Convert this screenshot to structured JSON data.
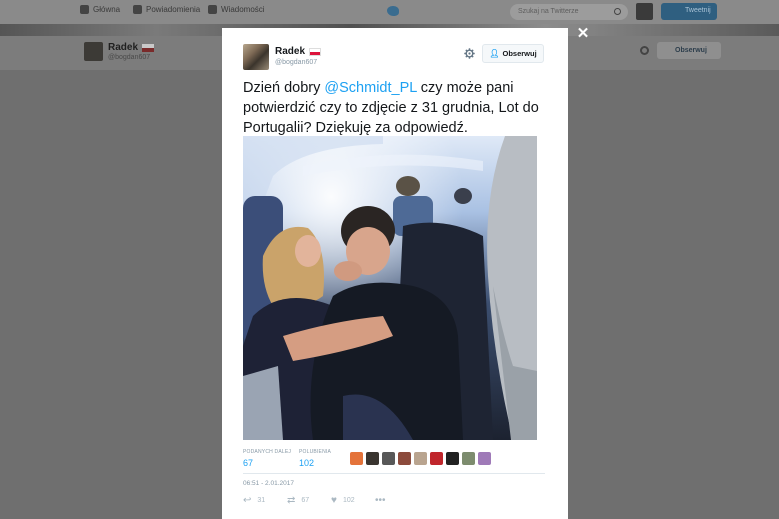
{
  "background": {
    "nav": [
      {
        "label": "Główna",
        "icon": "home-icon"
      },
      {
        "label": "Powiadomienia",
        "icon": "bell-icon"
      },
      {
        "label": "Wiadomości",
        "icon": "envelope-icon"
      }
    ],
    "search_placeholder": "Szukaj na Twitterze",
    "tweet_button": "Tweetnij",
    "profile": {
      "name": "Radek",
      "handle": "@bogdan607",
      "follow_label": "Obserwuj"
    }
  },
  "modal": {
    "author": {
      "name": "Radek",
      "handle": "@bogdan607"
    },
    "follow_label": "Obserwuj",
    "text": {
      "before": "Dzień dobry ",
      "mention": "@Schmidt_PL",
      "after": " czy może pani potwierdzić czy to zdjęcie z 31 grudnia, Lot do Portugalii? Dziękuję za odpowiedź."
    },
    "stats": {
      "retweets_label": "PODANYCH DALEJ",
      "retweets": "67",
      "likes_label": "POLUBIENIA",
      "likes": "102"
    },
    "liker_colors": [
      "#e4733a",
      "#3a3530",
      "#585858",
      "#8c4b3c",
      "#b9a48f",
      "#c0262c",
      "#222222",
      "#7d8c6e",
      "#9f7ab8"
    ],
    "timestamp": "06:51 - 2.01.2017",
    "actions": {
      "replies": "31",
      "retweets": "67",
      "likes": "102"
    }
  },
  "colors": {
    "accent": "#1da1f2",
    "overlay": "#6f6f6f"
  }
}
